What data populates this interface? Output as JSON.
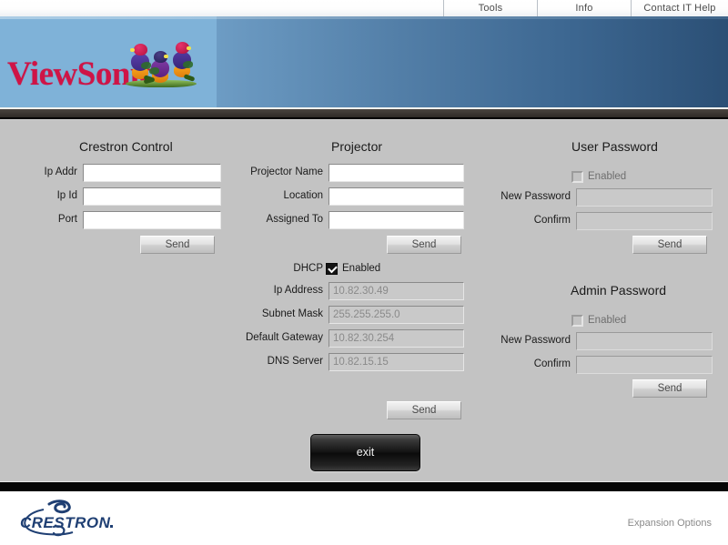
{
  "topnav": {
    "items": [
      {
        "label": "Tools"
      },
      {
        "label": "Info"
      },
      {
        "label": "Contact IT Help"
      }
    ]
  },
  "brand": {
    "wordmark": "ViewSonic",
    "registered": "®",
    "wordmark_color": "#cf1446"
  },
  "crestron_control": {
    "title": "Crestron Control",
    "fields": [
      {
        "label": "Ip Addr",
        "value": ""
      },
      {
        "label": "Ip Id",
        "value": ""
      },
      {
        "label": "Port",
        "value": ""
      }
    ],
    "send_label": "Send"
  },
  "projector": {
    "title": "Projector",
    "fields": [
      {
        "label": "Projector Name",
        "value": ""
      },
      {
        "label": "Location",
        "value": ""
      },
      {
        "label": "Assigned To",
        "value": ""
      }
    ],
    "send_label": "Send"
  },
  "network": {
    "dhcp_label": "DHCP",
    "dhcp_enabled_label": "Enabled",
    "dhcp_checked": true,
    "fields": [
      {
        "label": "Ip Address",
        "value": "10.82.30.49"
      },
      {
        "label": "Subnet Mask",
        "value": "255.255.255.0"
      },
      {
        "label": "Default Gateway",
        "value": "10.82.30.254"
      },
      {
        "label": "DNS Server",
        "value": "10.82.15.15"
      }
    ],
    "send_label": "Send"
  },
  "user_password": {
    "title": "User Password",
    "enabled_label": "Enabled",
    "enabled_checked": false,
    "fields": [
      {
        "label": "New Password",
        "value": ""
      },
      {
        "label": "Confirm",
        "value": ""
      }
    ],
    "send_label": "Send"
  },
  "admin_password": {
    "title": "Admin Password",
    "enabled_label": "Enabled",
    "enabled_checked": false,
    "fields": [
      {
        "label": "New Password",
        "value": ""
      },
      {
        "label": "Confirm",
        "value": ""
      }
    ],
    "send_label": "Send"
  },
  "exit_button": {
    "label": "exit"
  },
  "footer": {
    "logo_text": "CRESTRON",
    "logo_color": "#1f3f73",
    "expansion_label": "Expansion Options"
  }
}
